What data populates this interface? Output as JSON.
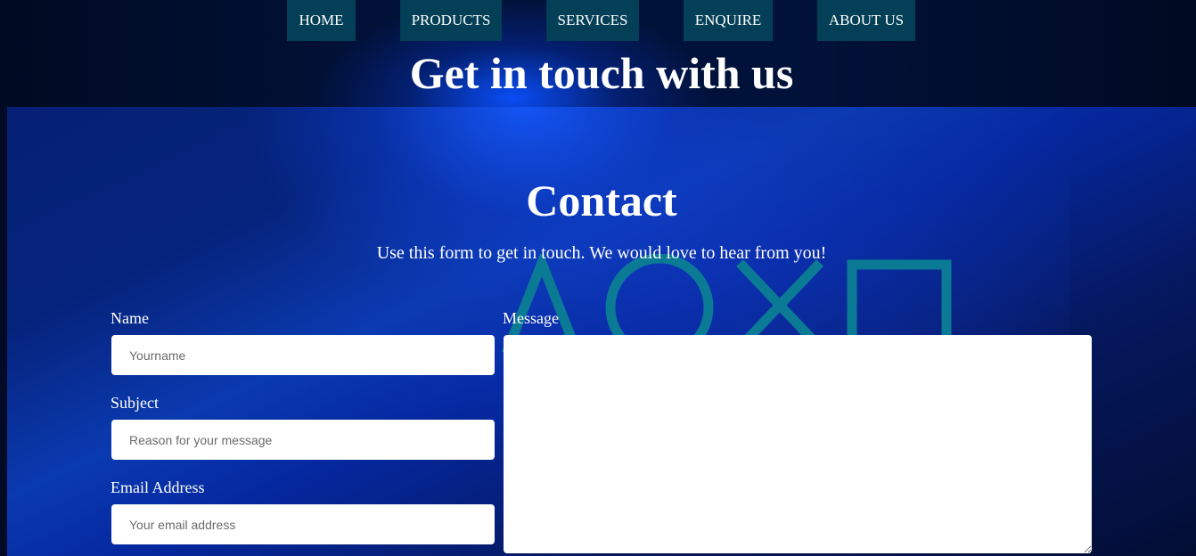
{
  "nav": {
    "items": [
      {
        "label": "HOME"
      },
      {
        "label": "PRODUCTS"
      },
      {
        "label": "SERVICES"
      },
      {
        "label": "ENQUIRE"
      },
      {
        "label": "ABOUT US"
      }
    ]
  },
  "hero": {
    "title": "Get in touch with us"
  },
  "contact": {
    "title": "Contact",
    "subtitle": "Use this form to get in touch. We would love to hear from you!"
  },
  "form": {
    "name": {
      "label": "Name",
      "placeholder": "Yourname",
      "value": ""
    },
    "subject": {
      "label": "Subject",
      "placeholder": "Reason for your message",
      "value": ""
    },
    "email": {
      "label": "Email Address",
      "placeholder": "Your email address",
      "value": ""
    },
    "message": {
      "label": "Message",
      "value": ""
    }
  },
  "colors": {
    "nav_bg": "#033f56",
    "text": "#ffffff",
    "deco_shapes": "#0b7a95",
    "background_blue": "#0a3ab0"
  },
  "icons": [
    "triangle-icon",
    "circle-icon",
    "cross-icon",
    "square-icon"
  ]
}
